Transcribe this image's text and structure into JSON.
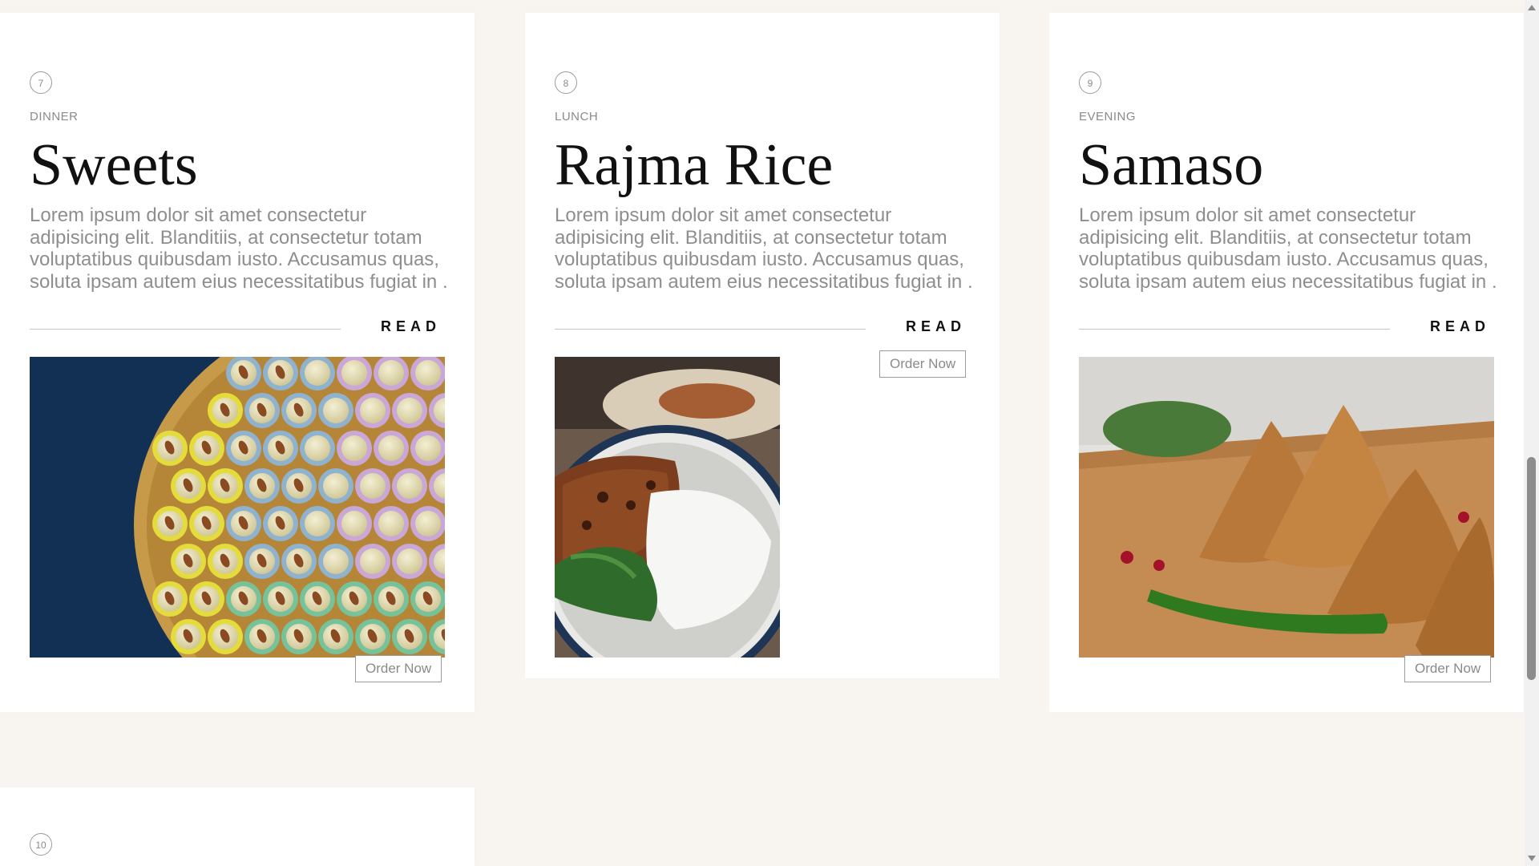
{
  "cards": [
    {
      "number": "7",
      "category": "DINNER",
      "title": "Sweets",
      "description": "Lorem ipsum dolor sit amet consectetur adipisicing elit. Blanditiis, at consectetur totam voluptatibus quibusdam iusto. Accusamus quas, soluta ipsam autem eius necessitatibus fugiat in .",
      "read_label": "READ",
      "order_label": "Order Now",
      "image": "tray-of-peda-sweets-with-almonds"
    },
    {
      "number": "8",
      "category": "LUNCH",
      "title": "Rajma Rice",
      "description": "Lorem ipsum dolor sit amet consectetur adipisicing elit. Blanditiis, at consectetur totam voluptatibus quibusdam iusto. Accusamus quas, soluta ipsam autem eius necessitatibus fugiat in .",
      "read_label": "READ",
      "order_label": "Order Now",
      "image": "bowl-of-rajma-curry-and-rice"
    },
    {
      "number": "9",
      "category": "EVENING",
      "title": "Samaso",
      "description": "Lorem ipsum dolor sit amet consectetur adipisicing elit. Blanditiis, at consectetur totam voluptatibus quibusdam iusto. Accusamus quas, soluta ipsam autem eius necessitatibus fugiat in .",
      "read_label": "READ",
      "order_label": "Order Now",
      "image": "samosas-on-wooden-board-with-green-chili"
    },
    {
      "number": "10"
    }
  ],
  "colors": {
    "page_background": "#f8f5f1",
    "card_background": "#ffffff",
    "muted_text": "#8e8e8e",
    "heading_text": "#111111"
  }
}
